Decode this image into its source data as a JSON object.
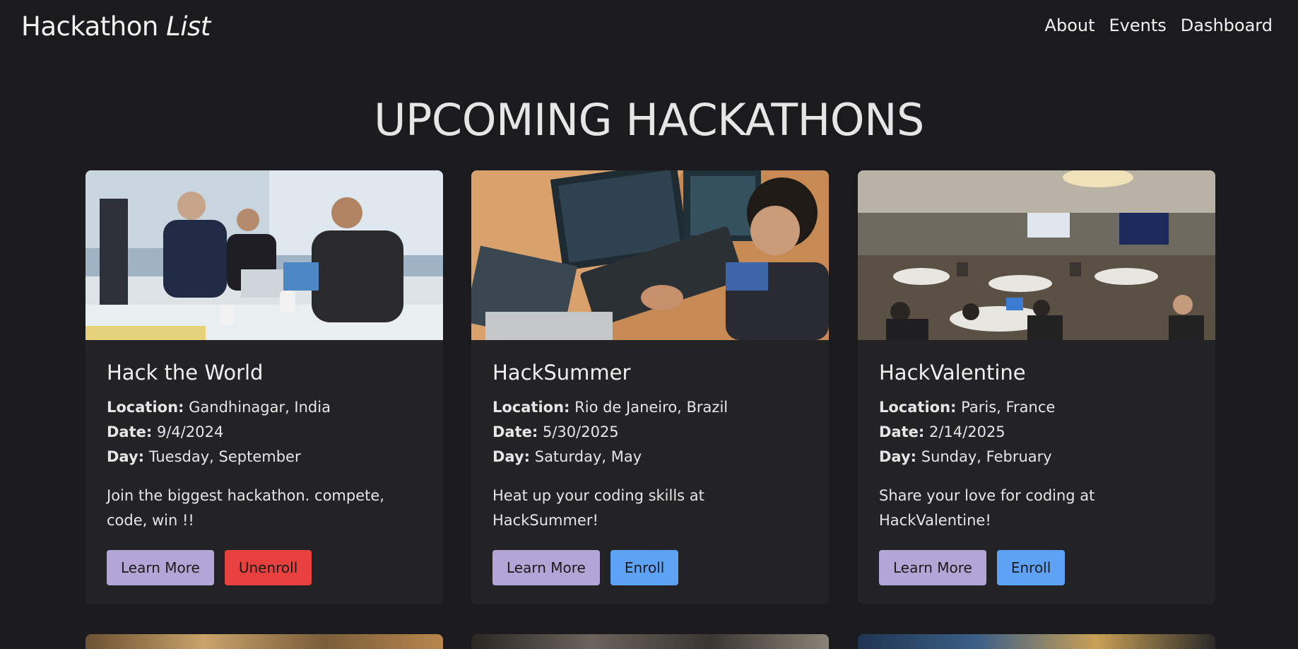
{
  "nav": {
    "brand_main": "Hackathon",
    "brand_italic": "List",
    "links": [
      "About",
      "Events",
      "Dashboard"
    ]
  },
  "page": {
    "title": "UPCOMING HACKATHONS"
  },
  "labels": {
    "location": "Location:",
    "date": "Date:",
    "day": "Day:",
    "learn_more": "Learn More"
  },
  "cards": [
    {
      "title": "Hack the World",
      "location": "Gandhinagar, India",
      "date": "9/4/2024",
      "day": "Tuesday, September",
      "description": "Join the biggest hackathon. compete, code, win !!",
      "action": "Unenroll",
      "action_color": "#e8403f"
    },
    {
      "title": "HackSummer",
      "location": "Rio de Janeiro, Brazil",
      "date": "5/30/2025",
      "day": "Saturday, May",
      "description": "Heat up your coding skills at HackSummer!",
      "action": "Enroll",
      "action_color": "#5ea2f6"
    },
    {
      "title": "HackValentine",
      "location": "Paris, France",
      "date": "2/14/2025",
      "day": "Sunday, February",
      "description": "Share your love for coding at HackValentine!",
      "action": "Enroll",
      "action_color": "#5ea2f6"
    }
  ],
  "colors": {
    "background": "#1b1b1d",
    "card": "#232326",
    "learn_more": "#b3a6d7"
  }
}
